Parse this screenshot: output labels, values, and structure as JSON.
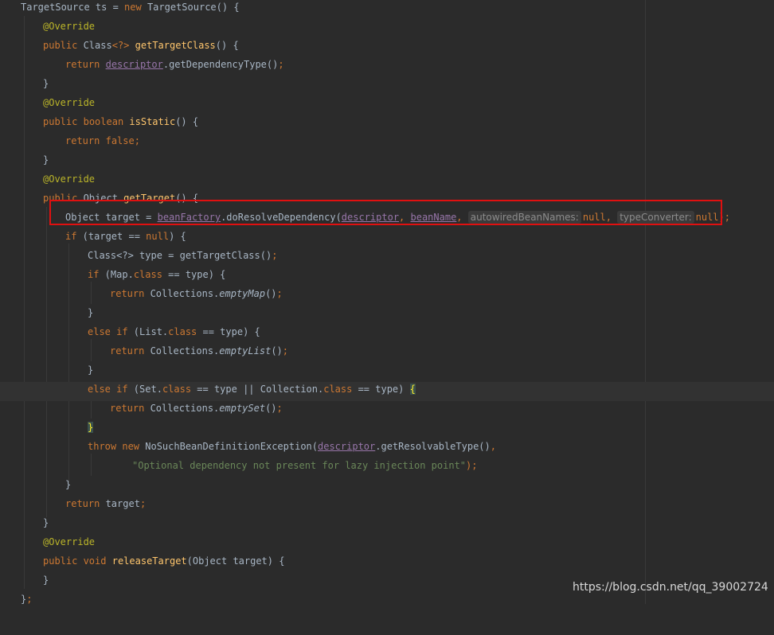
{
  "editor": {
    "line1": {
      "a": "TargetSource ts = ",
      "new": "new",
      "b": " TargetSource() {"
    },
    "line2": {
      "ann": "@Override"
    },
    "line3": {
      "pub": "public",
      "cls": " Class",
      "gen": "<?>",
      "sp": " ",
      "fn": "getTargetClass",
      "tail": "() {"
    },
    "line4": {
      "ret": "return",
      "sp": " ",
      "field": "descriptor",
      "call": ".getDependencyType()",
      "semi": ";"
    },
    "line5": {
      "brace": "}"
    },
    "line6": {
      "ann": "@Override"
    },
    "line7": {
      "pub": "public",
      "sp1": " ",
      "bool": "boolean",
      "sp2": " ",
      "fn": "isStatic",
      "tail": "() {"
    },
    "line8": {
      "ret": "return",
      "sp": " ",
      "false": "false",
      "semi": ";"
    },
    "line9": {
      "brace": "}"
    },
    "line10": {
      "ann": "@Override"
    },
    "line11": {
      "pub": "public",
      "obj": " Object ",
      "fn": "getTarget",
      "tail": "() {"
    },
    "line12": {
      "a": "Object target = ",
      "field1": "beanFactory",
      "call": ".doResolveDependency(",
      "field2": "descriptor",
      "comma1": ", ",
      "field3": "beanName",
      "comma2": ", ",
      "hint1": "autowiredBeanNames:",
      "null1": "null",
      "comma3": ", ",
      "hint2": "typeConverter:",
      "null2": "null",
      "end": ");"
    },
    "line13": {
      "if": "if",
      "a": " (target == ",
      "null": "null",
      "b": ") {"
    },
    "line14": {
      "a": "Class<?> type = getTargetClass()",
      "semi": ";"
    },
    "line15": {
      "if": "if",
      "a": " (Map.",
      "cls": "class",
      "b": " == type) {"
    },
    "line16": {
      "ret": "return",
      "a": " Collections.",
      "it": "emptyMap",
      "b": "()",
      "semi": ";"
    },
    "line17": {
      "brace": "}"
    },
    "line18": {
      "else": "else if",
      "a": " (List.",
      "cls": "class",
      "b": " == type) {"
    },
    "line19": {
      "ret": "return",
      "a": " Collections.",
      "it": "emptyList",
      "b": "()",
      "semi": ";"
    },
    "line20": {
      "brace": "}"
    },
    "line21": {
      "else": "else if",
      "a": " (Set.",
      "cls1": "class",
      "b": " == type || Collection.",
      "cls2": "class",
      "c": " == type) ",
      "brace": "{"
    },
    "line22": {
      "ret": "return",
      "a": " Collections.",
      "it": "emptySet",
      "b": "()",
      "semi": ";"
    },
    "line23": {
      "brace": "}"
    },
    "line24": {
      "throw": "throw new",
      "a": " NoSuchBeanDefinitionException(",
      "field": "descriptor",
      "b": ".getResolvableType()",
      "comma": ","
    },
    "line25": {
      "str": "\"Optional dependency not present for lazy injection point\"",
      "end": ");"
    },
    "line26": {
      "brace": "}"
    },
    "line27": {
      "ret": "return",
      "a": " target",
      "semi": ";"
    },
    "line28": {
      "brace": "}"
    },
    "line29": {
      "ann": "@Override"
    },
    "line30": {
      "pub": "public void",
      "sp": " ",
      "fn": "releaseTarget",
      "tail": "(Object target) {"
    },
    "line31": {
      "brace": "}"
    },
    "line32": {
      "brace": "}",
      "semi": ";"
    }
  },
  "watermark": "https://blog.csdn.net/qq_39002724"
}
